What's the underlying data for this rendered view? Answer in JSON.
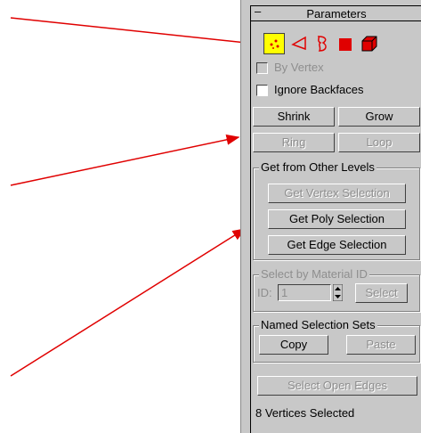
{
  "rollout": {
    "collapse_symbol": "–",
    "title": "Parameters"
  },
  "subobject_icons": [
    "vertex-icon",
    "edge-icon",
    "border-icon",
    "polygon-icon",
    "element-icon"
  ],
  "colors": {
    "panel_bg": "#c8c8c8",
    "icon_red": "#e00000",
    "selected_bg": "#ffff00",
    "arrow": "#e00000"
  },
  "options": {
    "by_vertex": "By Vertex",
    "ignore_backfaces": "Ignore Backfaces"
  },
  "buttons": {
    "shrink": "Shrink",
    "grow": "Grow",
    "ring": "Ring",
    "loop": "Loop"
  },
  "get_from_levels": {
    "title": "Get from Other Levels",
    "vertex": "Get Vertex Selection",
    "poly": "Get Poly Selection",
    "edge": "Get Edge Selection"
  },
  "material": {
    "title": "Select by Material ID",
    "id_label": "ID:",
    "id_value": "1",
    "select": "Select"
  },
  "named_sets": {
    "title": "Named Selection Sets",
    "copy": "Copy",
    "paste": "Paste"
  },
  "select_open_edges": "Select Open Edges",
  "status": "8 Vertices Selected"
}
